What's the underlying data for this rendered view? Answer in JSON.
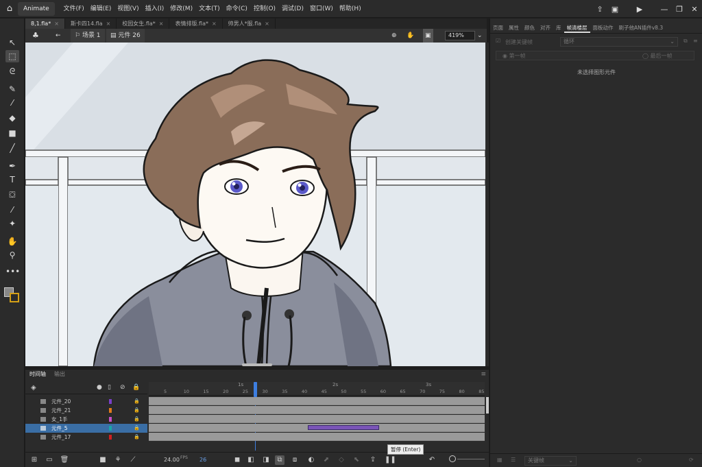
{
  "app": {
    "tab_label": "Animate"
  },
  "menu": [
    "文件(F)",
    "编辑(E)",
    "视图(V)",
    "插入(I)",
    "修改(M)",
    "文本(T)",
    "命令(C)",
    "控制(O)",
    "调试(D)",
    "窗口(W)",
    "帮助(H)"
  ],
  "doc_tabs": [
    {
      "label": "8,1.fla*"
    },
    {
      "label": "斯卡四14.fla"
    },
    {
      "label": "校园女生.fla*"
    },
    {
      "label": "表情排版.fla*"
    },
    {
      "label": "帅男人*服.fla"
    }
  ],
  "editbar": {
    "scene": "场景 1",
    "symbol": "元件 26",
    "zoom": "419%"
  },
  "right_panel": {
    "tabs": [
      "页面",
      "属性",
      "颜色",
      "对齐",
      "库",
      "帧清楼层",
      "面板动作",
      "刷子他AN插件v8.3"
    ],
    "active_tab": 5,
    "create_keyframe_label": "创建关键帧",
    "loop_select": "循环",
    "first_frame": "第一帧",
    "last_frame": "最后一帧",
    "no_symbol": "未选择图形元件",
    "footer_select": "关键帧"
  },
  "timeline": {
    "tabs": [
      "时间轴",
      "输出"
    ],
    "ruler_labels": [
      "1s",
      "2s",
      "3s"
    ],
    "ruler_numbers": [
      "5",
      "10",
      "15",
      "20",
      "25",
      "30",
      "35",
      "40",
      "45",
      "50",
      "55",
      "60",
      "65",
      "70",
      "75",
      "80",
      "85"
    ],
    "layers": [
      {
        "name": "元件_20",
        "color": "#7a3fc8"
      },
      {
        "name": "元件_21",
        "color": "#e07a1a"
      },
      {
        "name": "女_1手",
        "color": "#c84fc8"
      },
      {
        "name": "元件_5",
        "color": "#1aa6a6",
        "selected": true
      },
      {
        "name": "元件_17",
        "color": "#d02020"
      }
    ],
    "fps": "24.00",
    "fps_label": "FPS",
    "current_frame": "26",
    "tooltip": "暂停 (Enter)"
  }
}
